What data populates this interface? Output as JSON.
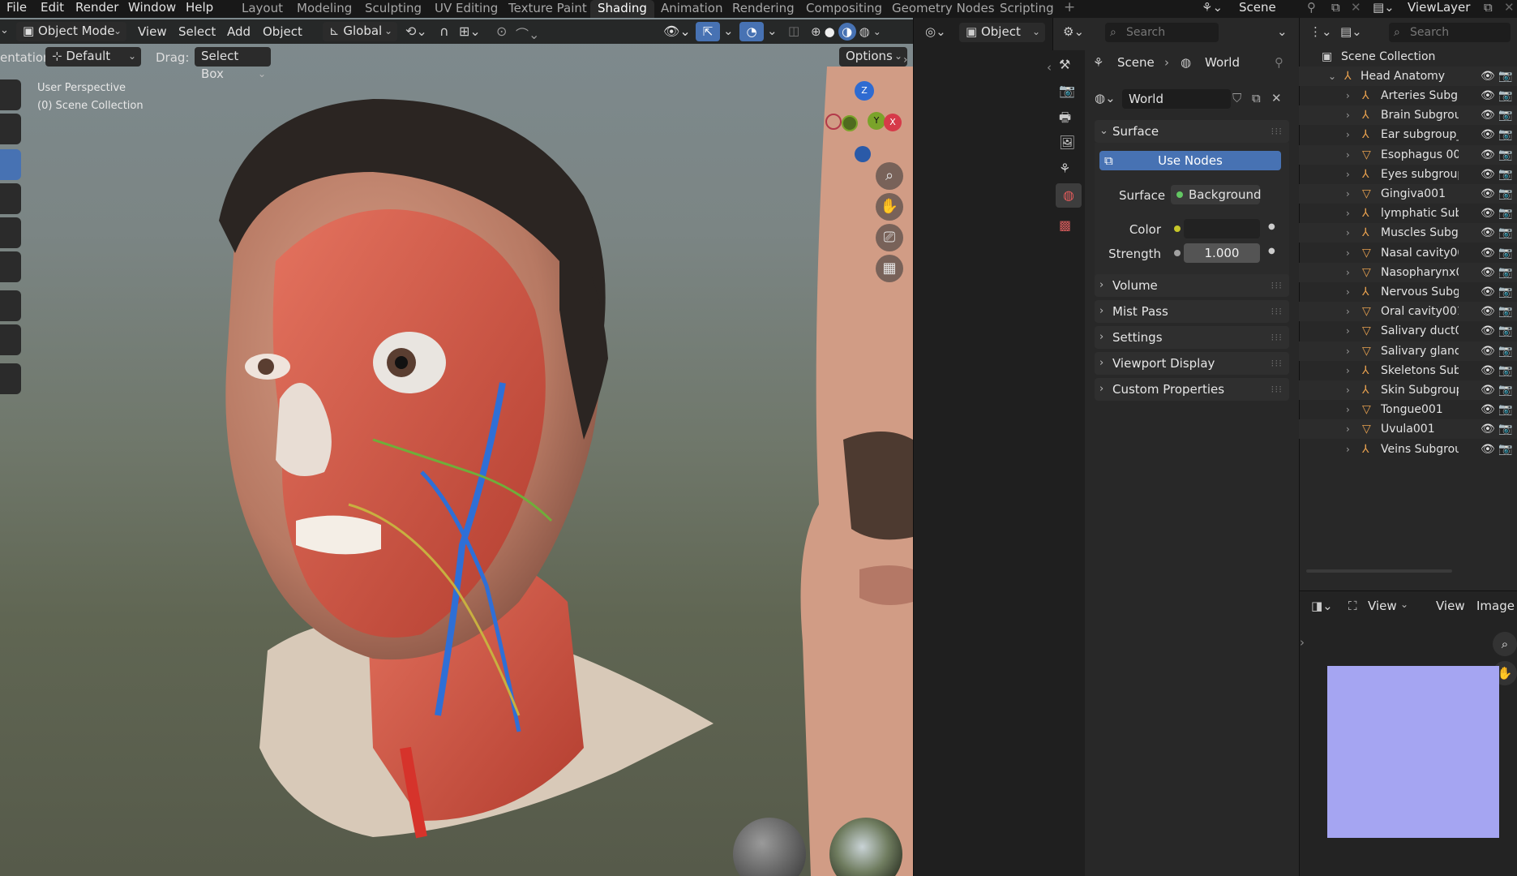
{
  "menu": {
    "file": "File",
    "edit": "Edit",
    "render": "Render",
    "window": "Window",
    "help": "Help"
  },
  "workspaces": [
    "Layout",
    "Modeling",
    "Sculpting",
    "UV Editing",
    "Texture Paint",
    "Shading",
    "Animation",
    "Rendering",
    "Compositing",
    "Geometry Nodes",
    "Scripting"
  ],
  "active_workspace": "Shading",
  "top_right": {
    "scene": "Scene",
    "view_layer": "ViewLayer"
  },
  "viewport": {
    "mode": "Object Mode",
    "menus": {
      "view": "View",
      "select": "Select",
      "add": "Add",
      "object": "Object"
    },
    "transform_orientation": "Global",
    "orientation_label": "entation:",
    "orientation_value": "Default",
    "drag_label": "Drag:",
    "drag_value": "Select Box",
    "options": "Options",
    "overlay_line1": "User Perspective",
    "overlay_line2": "(0) Scene Collection",
    "gizmo": {
      "z": "Z",
      "y": "Y",
      "x": "X"
    }
  },
  "midstrip": {
    "object_label": "Object"
  },
  "properties": {
    "search_placeholder": "Search",
    "breadcrumb_scene": "Scene",
    "breadcrumb_world": "World",
    "world_name": "World",
    "surface_panel": "Surface",
    "use_nodes": "Use Nodes",
    "surface_label": "Surface",
    "surface_value": "Background",
    "color_label": "Color",
    "strength_label": "Strength",
    "strength_value": "1.000",
    "panels": [
      "Volume",
      "Mist Pass",
      "Settings",
      "Viewport Display",
      "Custom Properties"
    ]
  },
  "outliner": {
    "search_placeholder": "Search",
    "root": "Scene Collection",
    "collection": "Head Anatomy",
    "items": [
      {
        "name": "Arteries Subgr",
        "type": "armature"
      },
      {
        "name": "Brain Subgrou",
        "type": "armature"
      },
      {
        "name": "Ear subgroup_",
        "type": "armature"
      },
      {
        "name": "Esophagus 00",
        "type": "mesh"
      },
      {
        "name": "Eyes subgroup",
        "type": "armature"
      },
      {
        "name": "Gingiva001",
        "type": "mesh"
      },
      {
        "name": "lymphatic Sub",
        "type": "armature"
      },
      {
        "name": "Muscles Subgi",
        "type": "armature"
      },
      {
        "name": "Nasal cavity00",
        "type": "mesh"
      },
      {
        "name": "Nasopharynx0",
        "type": "mesh"
      },
      {
        "name": "Nervous Subg",
        "type": "armature"
      },
      {
        "name": "Oral cavity001",
        "type": "mesh"
      },
      {
        "name": "Salivary duct0",
        "type": "mesh"
      },
      {
        "name": "Salivary gland(",
        "type": "mesh"
      },
      {
        "name": "Skeletons Sub",
        "type": "armature"
      },
      {
        "name": "Skin Subgroup",
        "type": "armature"
      },
      {
        "name": "Tongue001",
        "type": "mesh"
      },
      {
        "name": "Uvula001",
        "type": "mesh"
      },
      {
        "name": "Veins Subgrou",
        "type": "armature"
      }
    ]
  },
  "image_editor": {
    "view_menu_label": "View",
    "view": "View",
    "image": "Image"
  },
  "colors": {
    "accent": "#4772b3",
    "selected_tab": "#ffffff",
    "outliner_armature": "#e8a14f",
    "outliner_mesh": "#e8a14f",
    "node_socket_green": "#63c763",
    "node_socket_yellow": "#c7c729",
    "normal_map": "#a5a5f2"
  }
}
